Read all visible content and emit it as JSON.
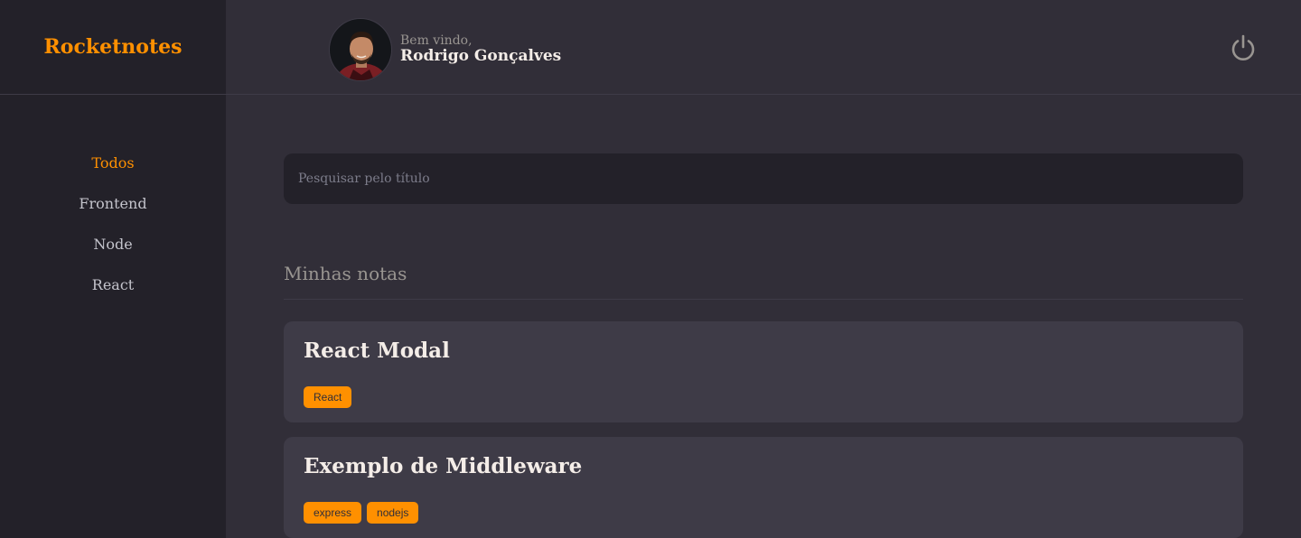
{
  "brand": {
    "name": "Rocketnotes"
  },
  "colors": {
    "accent": "#FF9000",
    "background": "#312E38",
    "sidebar": "#232129",
    "card": "#3E3B47"
  },
  "header": {
    "greeting": "Bem vindo,",
    "user_name": "Rodrigo Gonçalves",
    "logout_icon": "power-icon"
  },
  "menu": {
    "items": [
      {
        "label": "Todos",
        "active": true
      },
      {
        "label": "Frontend",
        "active": false
      },
      {
        "label": "Node",
        "active": false
      },
      {
        "label": "React",
        "active": false
      }
    ]
  },
  "search": {
    "placeholder": "Pesquisar pelo título",
    "value": ""
  },
  "notes_section": {
    "title": "Minhas notas",
    "notes": [
      {
        "title": "React Modal",
        "tags": [
          "React"
        ]
      },
      {
        "title": "Exemplo de Middleware",
        "tags": [
          "express",
          "nodejs"
        ]
      }
    ]
  }
}
